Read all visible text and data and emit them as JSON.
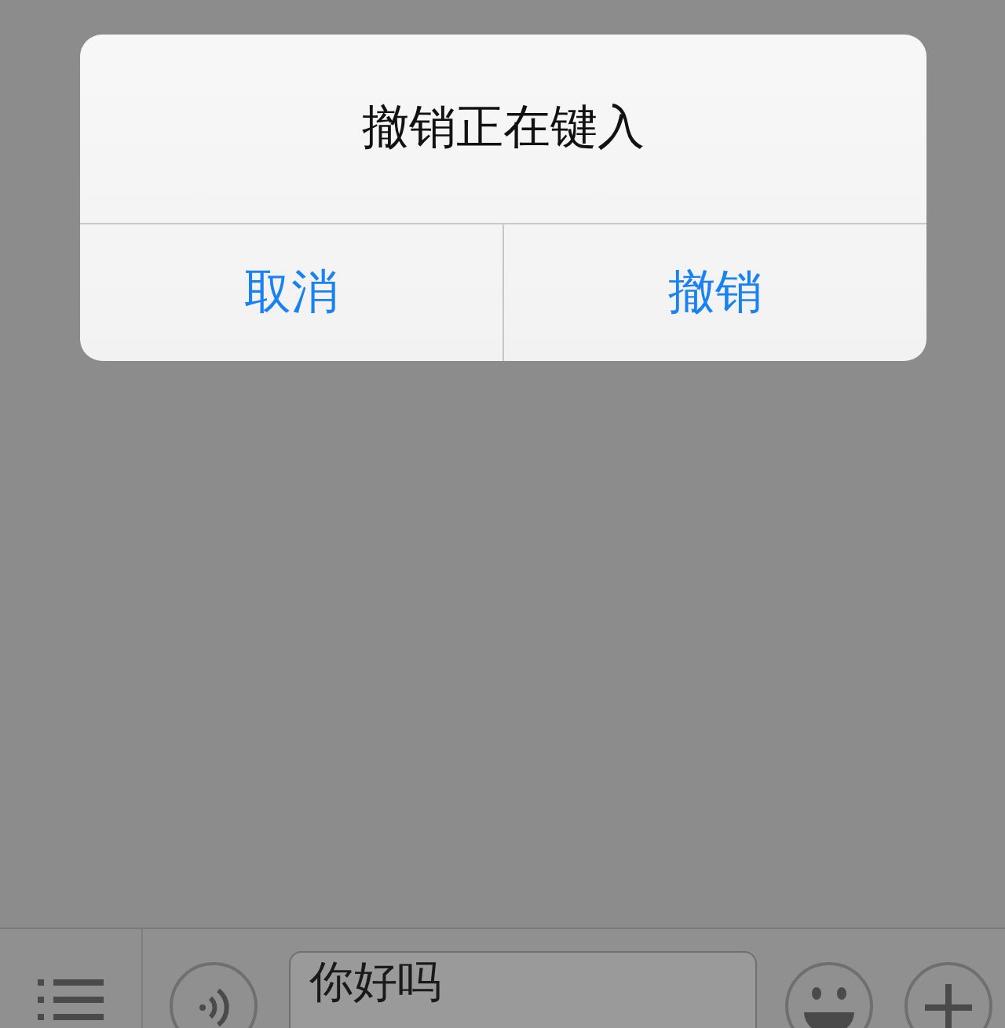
{
  "alert": {
    "title": "撤销正在键入",
    "buttons": [
      {
        "label": "取消"
      },
      {
        "label": "撤销"
      }
    ]
  },
  "input_bar": {
    "message_field": {
      "value": "你好吗"
    }
  }
}
